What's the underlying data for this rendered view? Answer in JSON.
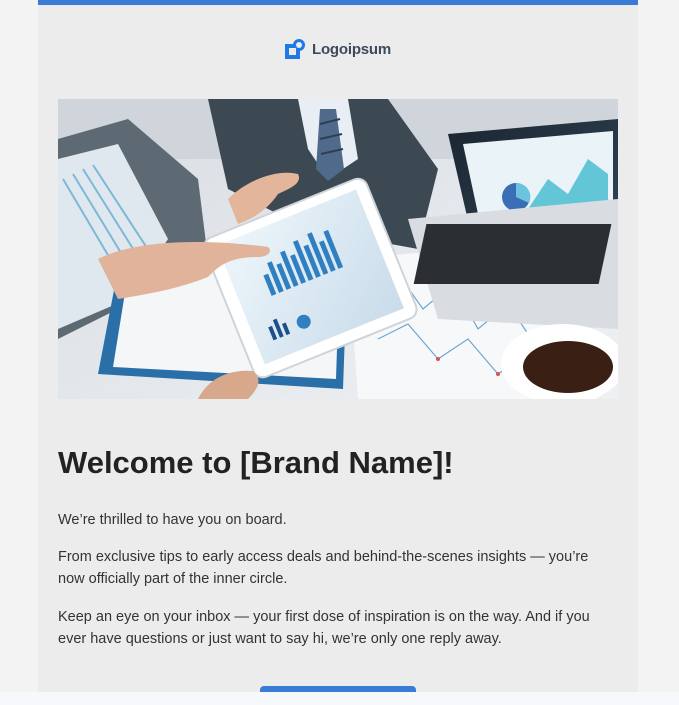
{
  "brand": {
    "logo_text": "Logoipsum",
    "accent_color": "#3a7bd5"
  },
  "hero": {
    "icon": "business-analytics-photo"
  },
  "content": {
    "headline": "Welcome to [Brand Name]!",
    "paragraphs": [
      "We’re thrilled to have you on board.",
      "From exclusive tips to early access deals and behind-the-scenes insights — you’re now officially part of the inner circle.",
      "Keep an eye on your inbox — your first dose of inspiration is on the way. And if you ever have questions or just want to say hi, we’re only one reply away."
    ]
  },
  "cta": {
    "label": ""
  }
}
